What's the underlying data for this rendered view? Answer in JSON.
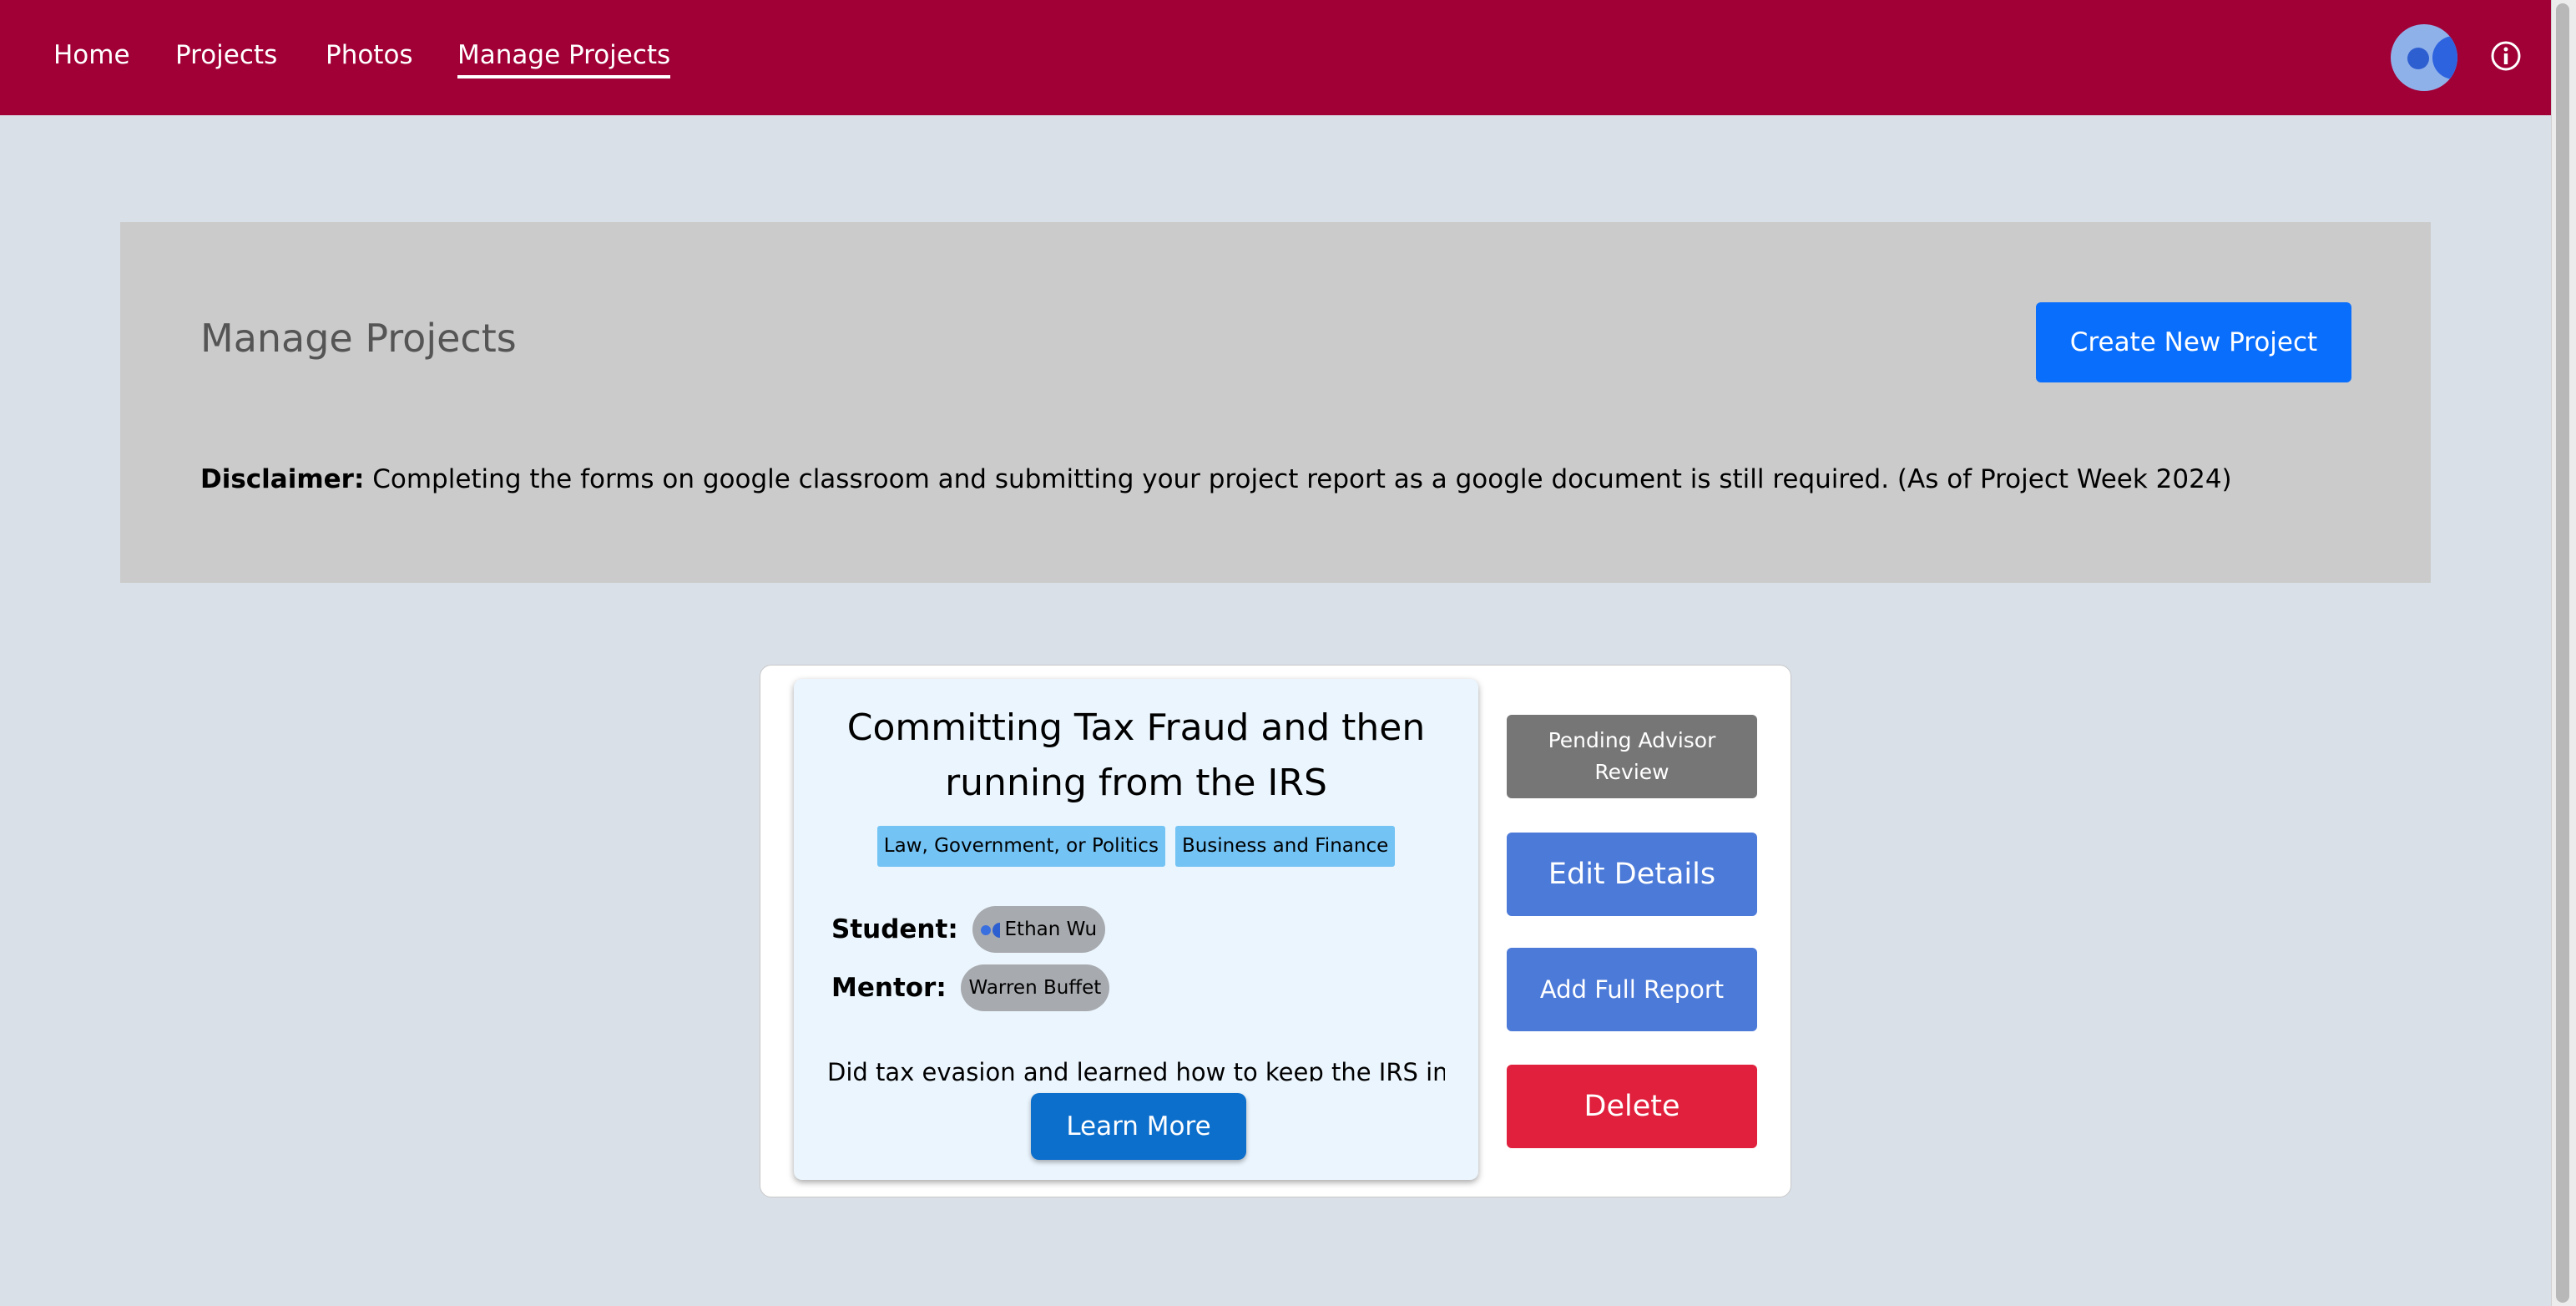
{
  "nav": {
    "links": [
      "Home",
      "Projects",
      "Photos",
      "Manage Projects"
    ],
    "active": "Manage Projects",
    "brand_color": "#a10036"
  },
  "header": {
    "title": "Manage Projects",
    "create_button": "Create New Project",
    "disclaimer_label": "Disclaimer:",
    "disclaimer_text": " Completing the forms on google classroom and submitting your project report as a google document is still required. (As of Project Week 2024)"
  },
  "project": {
    "title": "Committing Tax Fraud and then running from the IRS",
    "tags": [
      "Law, Government, or Politics",
      "Business and Finance"
    ],
    "student_label": "Student:",
    "student_name": "Ethan Wu",
    "mentor_label": "Mentor:",
    "mentor_name": "Warren Buffet",
    "description": "Did tax evasion and learned how to keep the IRS in",
    "learn_more": "Learn More",
    "status": "Pending Advisor Review",
    "edit_button": "Edit Details",
    "report_button": "Add Full Report",
    "delete_button": "Delete"
  },
  "icons": {
    "avatar": "user-avatar",
    "info": "info-icon"
  }
}
